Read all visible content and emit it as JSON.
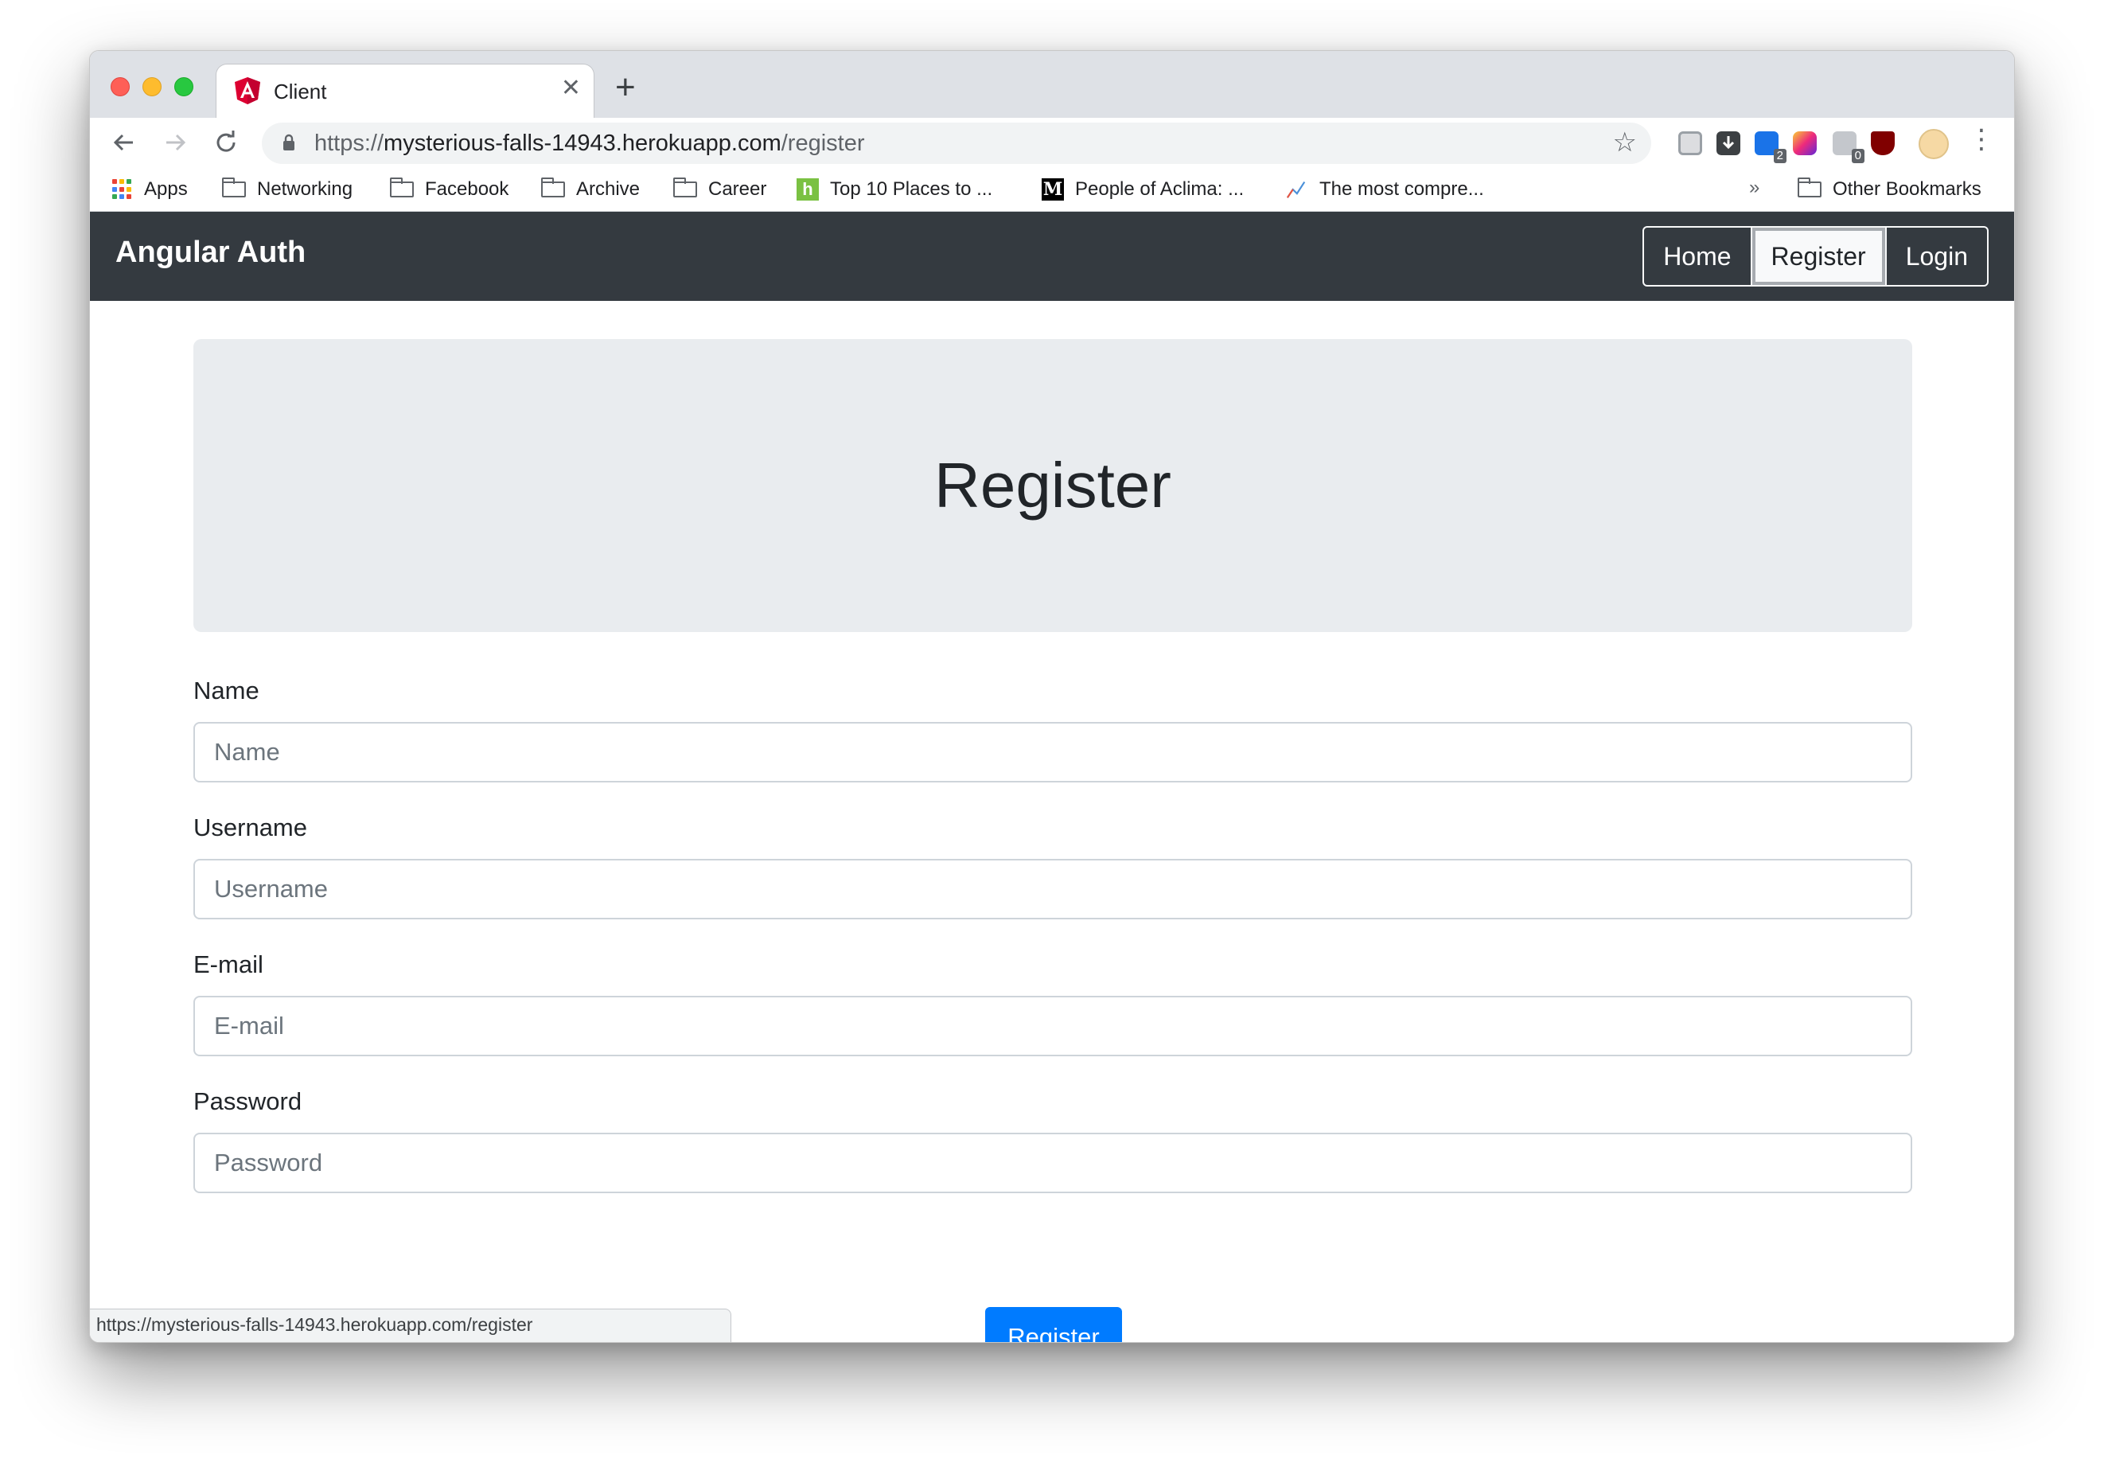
{
  "tab": {
    "title": "Client",
    "close_glyph": "✕",
    "new_tab_glyph": "+"
  },
  "address_bar": {
    "url_scheme": "https://",
    "url_host": "mysterious-falls-14943.herokuapp.com",
    "url_path": "/register"
  },
  "bookmarks": [
    {
      "label": "Apps",
      "icon": "apps-grid-icon"
    },
    {
      "label": "Networking",
      "icon": "folder-icon"
    },
    {
      "label": "Facebook",
      "icon": "folder-icon"
    },
    {
      "label": "Archive",
      "icon": "folder-icon"
    },
    {
      "label": "Career",
      "icon": "folder-icon"
    },
    {
      "label": "Top 10 Places to ...",
      "icon": "houzz-icon"
    },
    {
      "label": "People of Aclima: ...",
      "icon": "medium-icon"
    },
    {
      "label": "The most compre...",
      "icon": "chart-line-icon"
    },
    {
      "label": "Other Bookmarks",
      "icon": "folder-icon"
    }
  ],
  "bookmarks_overflow": "»",
  "extensions": [
    {
      "icon": "screenshot-extension-icon",
      "badge": ""
    },
    {
      "icon": "download-extension-icon",
      "badge": ""
    },
    {
      "icon": "s-extension-icon",
      "badge": "2"
    },
    {
      "icon": "instagram-extension-icon",
      "badge": ""
    },
    {
      "icon": "puzzle-extension-icon",
      "badge": "0"
    },
    {
      "icon": "ublock-extension-icon",
      "badge": ""
    }
  ],
  "navbar": {
    "brand": "Angular Auth",
    "links": [
      "Home",
      "Register",
      "Login"
    ],
    "active": "Register"
  },
  "page": {
    "heading": "Register",
    "fields": [
      {
        "label": "Name",
        "placeholder": "Name",
        "value": ""
      },
      {
        "label": "Username",
        "placeholder": "Username",
        "value": ""
      },
      {
        "label": "E-mail",
        "placeholder": "E-mail",
        "value": ""
      },
      {
        "label": "Password",
        "placeholder": "Password",
        "value": ""
      }
    ],
    "submit_label": "Register"
  },
  "status_bar": {
    "text": "https://mysterious-falls-14943.herokuapp.com/register"
  },
  "colors": {
    "navbar_bg": "#343a40",
    "jumbotron_bg": "#e9ecef",
    "primary": "#007bff"
  }
}
